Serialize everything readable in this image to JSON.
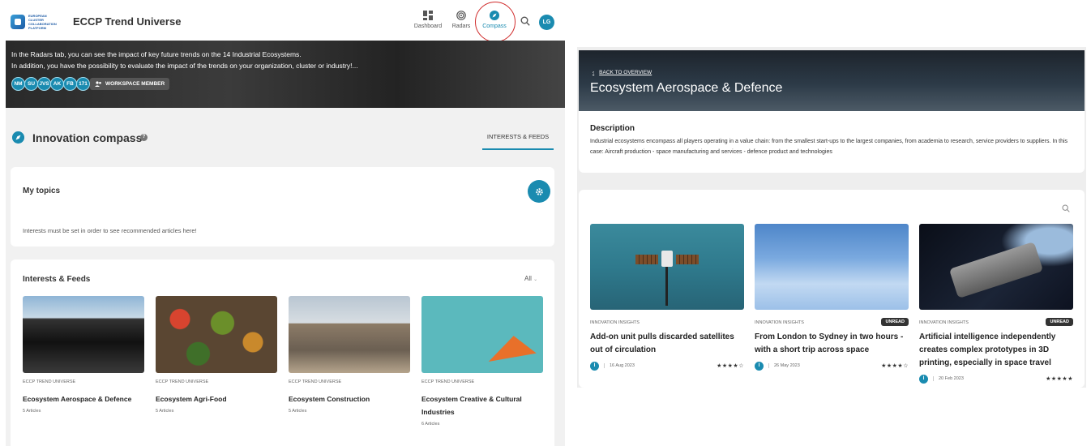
{
  "left": {
    "logo_text": "EUROPEAN CLUSTER COLLABORATION PLATFORM",
    "app_title": "ECCP Trend Universe",
    "nav": [
      {
        "label": "Dashboard",
        "icon": "dashboard-icon"
      },
      {
        "label": "Radars",
        "icon": "radar-icon"
      },
      {
        "label": "Compass",
        "icon": "compass-icon",
        "active": true
      }
    ],
    "user_initials": "LG",
    "hero": {
      "line1": "In the Radars tab, you can see the impact of key future trends on the 14 Industrial Ecosystems.",
      "line2": "In addition, you have the possibility to evaluate the impact of the trends on your organization, cluster or industry!...",
      "members": [
        "NM",
        "SU",
        "JVS",
        "AK",
        "FB",
        "171"
      ],
      "badge": "WORKSPACE MEMBER"
    },
    "section_title": "Innovation compass",
    "tab": "INTERESTS & FEEDS",
    "topics": {
      "title": "My topics",
      "note": "Interests must be set in order to see recommended articles here!"
    },
    "feeds": {
      "title": "Interests & Feeds",
      "filter": "All",
      "items": [
        {
          "source": "ECCP TREND UNIVERSE",
          "title": "Ecosystem Aerospace & Defence",
          "count": "5 Articles"
        },
        {
          "source": "ECCP TREND UNIVERSE",
          "title": "Ecosystem Agri-Food",
          "count": "5 Articles"
        },
        {
          "source": "ECCP TREND UNIVERSE",
          "title": "Ecosystem Construction",
          "count": "5 Articles"
        },
        {
          "source": "ECCP TREND UNIVERSE",
          "title": "Ecosystem Creative & Cultural Industries",
          "count": "6 Articles"
        }
      ]
    }
  },
  "right": {
    "back": "BACK TO OVERVIEW",
    "title": "Ecosystem Aerospace & Defence",
    "desc_heading": "Description",
    "desc_text": "Industrial ecosystems encompass all players operating in a value chain: from the smallest start-ups to the largest companies, from academia to research, service providers to suppliers. In this case: Aircraft production - space manufacturing and services - defence product and technologies",
    "articles": [
      {
        "source": "INNOVATION INSIGHTS",
        "unread": "",
        "title": "Add-on unit pulls discarded satellites out of circulation",
        "author": "I",
        "date": "16 Aug 2023",
        "stars": "★★★★☆"
      },
      {
        "source": "INNOVATION INSIGHTS",
        "unread": "UNREAD",
        "title": "From London to Sydney in two hours - with a short trip across space",
        "author": "I",
        "date": "26 May 2023",
        "stars": "★★★★☆"
      },
      {
        "source": "INNOVATION INSIGHTS",
        "unread": "UNREAD",
        "title": "Artificial intelligence independently creates complex prototypes in 3D printing, especially in space travel",
        "author": "I",
        "date": "20 Feb 2023",
        "stars": "★★★★★"
      }
    ]
  },
  "colors": {
    "accent": "#1a8bb0",
    "highlight_ring": "#d02a2a"
  }
}
